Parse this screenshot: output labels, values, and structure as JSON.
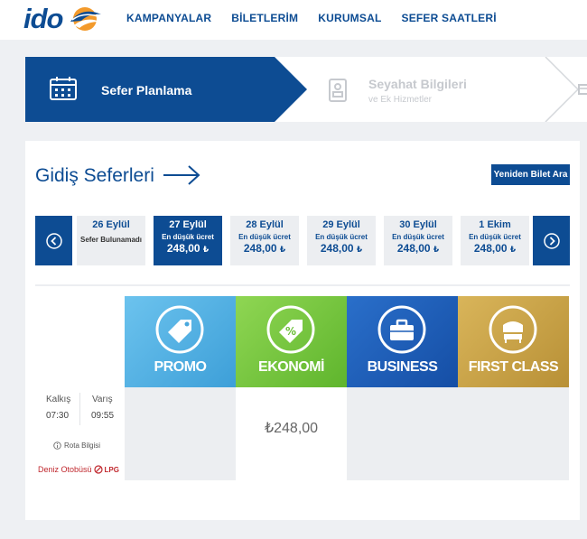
{
  "header": {
    "logo_text": "ido",
    "nav": [
      "KAMPANYALAR",
      "BİLETLERİM",
      "KURUMSAL",
      "SEFER SAATLERİ"
    ]
  },
  "steps": [
    {
      "label": "Sefer Planlama",
      "sub": ""
    },
    {
      "label": "Seyahat Bilgileri",
      "sub": "ve Ek Hizmetler"
    }
  ],
  "main": {
    "title": "Gidiş Seferleri",
    "search_again": "Yeniden Bilet Ara",
    "dates": [
      {
        "date": "26 Eylül",
        "status": "Sefer Bulunamadı",
        "price": "",
        "currency": ""
      },
      {
        "date": "27 Eylül",
        "status": "En düşük ücret",
        "price": "248,00",
        "currency": "₺"
      },
      {
        "date": "28 Eylül",
        "status": "En düşük ücret",
        "price": "248,00",
        "currency": "₺"
      },
      {
        "date": "29 Eylül",
        "status": "En düşük ücret",
        "price": "248,00",
        "currency": "₺"
      },
      {
        "date": "30 Eylül",
        "status": "En düşük ücret",
        "price": "248,00",
        "currency": "₺"
      },
      {
        "date": "1 Ekim",
        "status": "En düşük ücret",
        "price": "248,00",
        "currency": "₺"
      }
    ],
    "fares": [
      "PROMO",
      "EKONOMİ",
      "BUSINESS",
      "FIRST CLASS"
    ],
    "trip": {
      "departure_label": "Kalkış",
      "departure_time": "07:30",
      "arrival_label": "Varış",
      "arrival_time": "09:55",
      "route_info": "Rota Bilgisi",
      "vessel": "Deniz Otobüsü",
      "fuel": "LPG",
      "prices": [
        "",
        "₺248,00",
        "",
        ""
      ]
    }
  },
  "colors": {
    "brand_blue": "#0d4c93",
    "promo": "#55b3e4",
    "ekonomi": "#74c93a",
    "business": "#1b5db8",
    "first_class": "#c7a246",
    "vessel_red": "#c0282e"
  }
}
